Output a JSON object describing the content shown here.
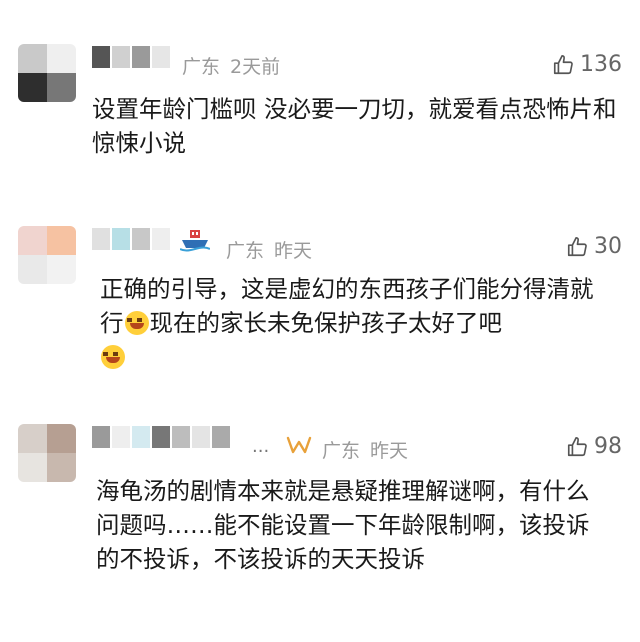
{
  "comments": [
    {
      "location": "广东",
      "time": "2天前",
      "likes": "136",
      "text": "设置年龄门槛呗 没必要一刀切，就爱看点恐怖片和惊悚小说"
    },
    {
      "location": "广东",
      "time": "昨天",
      "likes": "30",
      "text_part1": "正确的引导，这是虚幻的东西孩子们能分得清就行",
      "text_part2": "现在的家长未免保护孩子太好了吧",
      "badge_icon": "ship-icon"
    },
    {
      "location": "广东",
      "time": "昨天",
      "likes": "98",
      "ellipsis": "...",
      "badge_icon": "w-badge-icon",
      "text": "海龟汤的剧情本来就是悬疑推理解谜啊，有什么问题吗……能不能设置一下年龄限制啊，该投诉的不投诉，不该投诉的天天投诉"
    }
  ],
  "icons": {
    "like": "thumbs-up-icon",
    "emoji": "laughing-tears-emoji-icon"
  },
  "colors": {
    "meta_text": "#9a9a9a",
    "body_text": "#1a1a1a",
    "badge_orange": "#e8a13a"
  }
}
